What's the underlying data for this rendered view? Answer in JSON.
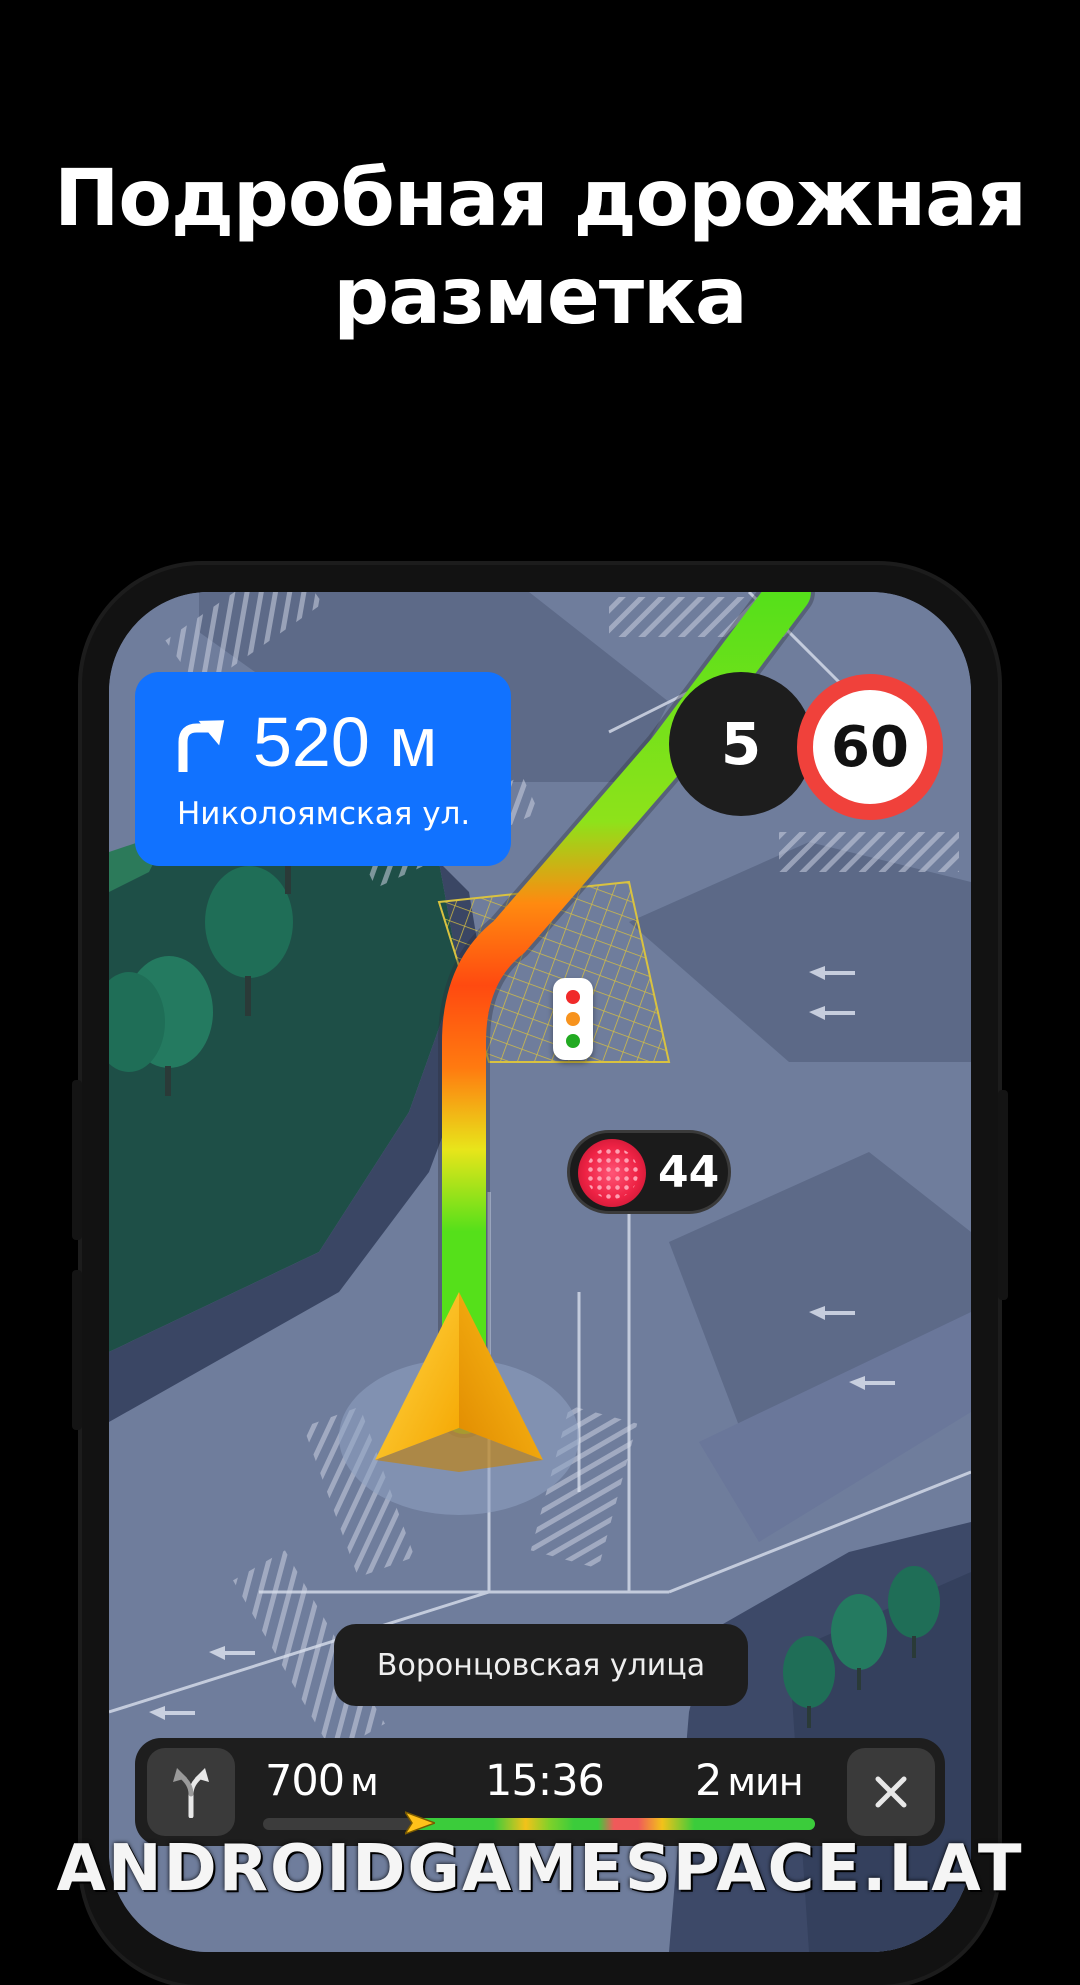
{
  "headline": {
    "line1": "Подробная дорожная",
    "line2": "разметка"
  },
  "maneuver": {
    "distance": "520 м",
    "street": "Николоямская ул.",
    "icon": "turn-right-arrow-icon",
    "color": "#1172ff"
  },
  "lane_count": "5",
  "speed_limit": "60",
  "traffic_light_timer": {
    "seconds": "44",
    "icon": "red-light-icon"
  },
  "current_street": "Воронцовская улица",
  "trip": {
    "distance_value": "700",
    "distance_unit": "м",
    "arrival_time": "15:36",
    "duration_value": "2",
    "duration_unit": "мин",
    "route_options_icon": "route-fork-icon",
    "close_icon": "close-icon"
  },
  "watermark": "ANDROIDGAMESPACE.LAT"
}
